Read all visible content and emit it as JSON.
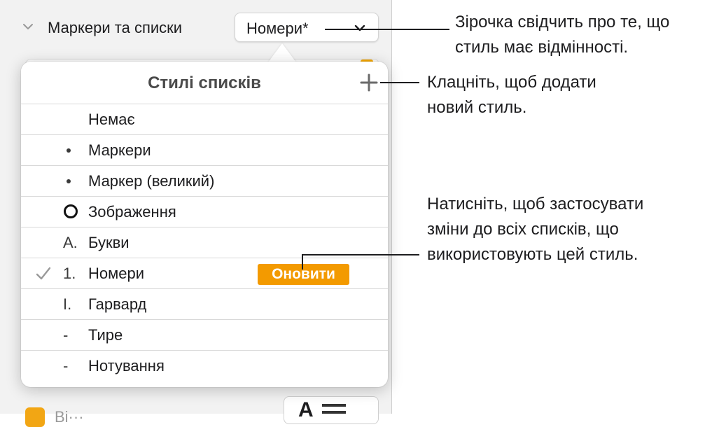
{
  "inspector": {
    "section_title": "Маркери та списки",
    "list_style_value": "Номери*",
    "bottom_label": "Ві···",
    "bottom_glyph": "A"
  },
  "popover": {
    "title": "Стилі списків",
    "add_label": "+",
    "items": [
      {
        "marker": "",
        "label": "Немає"
      },
      {
        "marker": "bullet",
        "label": "Маркери"
      },
      {
        "marker": "bullet",
        "label": "Маркер (великий)"
      },
      {
        "marker": "ring",
        "label": "Зображення"
      },
      {
        "marker": "A.",
        "label": "Букви"
      },
      {
        "marker": "1.",
        "label": "Номери",
        "selected": true
      },
      {
        "marker": "I.",
        "label": "Гарвард"
      },
      {
        "marker": "-",
        "label": "Тире"
      },
      {
        "marker": "-",
        "label": "Нотування"
      }
    ],
    "update_label": "Оновити"
  },
  "callouts": {
    "asterisk": [
      "Зірочка свідчить про те, що",
      "стиль має відмінності."
    ],
    "add": [
      "Клацніть, щоб додати",
      "новий стиль."
    ],
    "update": [
      "Натисніть, щоб застосувати",
      "зміни до всіх списків, що",
      "використовують цей стиль."
    ]
  },
  "colors": {
    "accent": "#f39a00",
    "panel_bg": "#f2f2f2"
  }
}
